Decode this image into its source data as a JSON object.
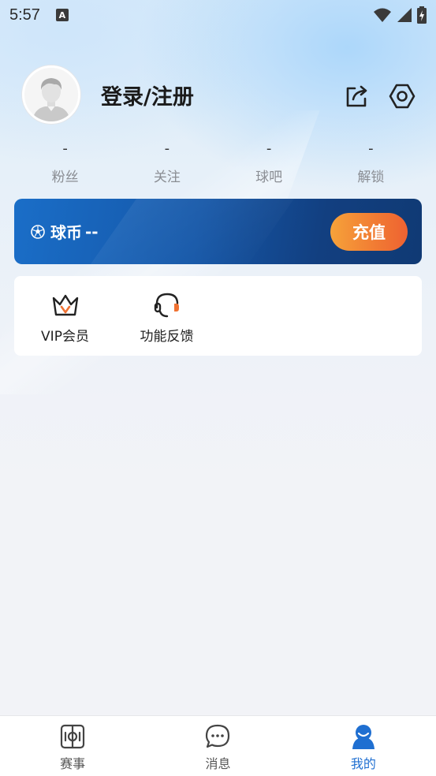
{
  "status_bar": {
    "time": "5:57",
    "indicator": "A",
    "icons": [
      "wifi-icon",
      "signal-icon",
      "battery-charging-icon"
    ]
  },
  "profile": {
    "login_label": "登录/注册",
    "icons": [
      "share-icon",
      "settings-icon"
    ]
  },
  "stats": [
    {
      "value": "-",
      "label": "粉丝"
    },
    {
      "value": "-",
      "label": "关注"
    },
    {
      "value": "-",
      "label": "球吧"
    },
    {
      "value": "-",
      "label": "解锁"
    }
  ],
  "coin_card": {
    "icon": "soccer-ball-icon",
    "label": "球币",
    "value": "--",
    "recharge_label": "充值"
  },
  "features": [
    {
      "label": "VIP会员",
      "icon": "crown-icon"
    },
    {
      "label": "功能反馈",
      "icon": "headset-icon"
    }
  ],
  "tabbar": {
    "tabs": [
      {
        "label": "赛事",
        "icon": "match-board-icon",
        "active": false
      },
      {
        "label": "消息",
        "icon": "chat-bubble-icon",
        "active": false
      },
      {
        "label": "我的",
        "icon": "user-icon",
        "active": true
      }
    ],
    "active_color": "#1f6fd1"
  },
  "colors": {
    "coin_card": "#1557a8",
    "recharge_button": "#f17a33"
  }
}
